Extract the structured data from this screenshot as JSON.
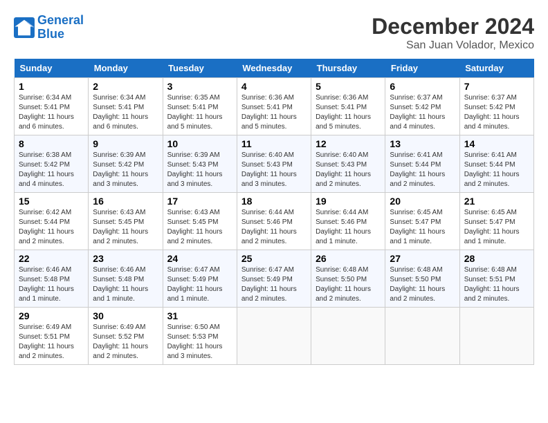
{
  "header": {
    "logo_line1": "General",
    "logo_line2": "Blue",
    "month": "December 2024",
    "location": "San Juan Volador, Mexico"
  },
  "days_of_week": [
    "Sunday",
    "Monday",
    "Tuesday",
    "Wednesday",
    "Thursday",
    "Friday",
    "Saturday"
  ],
  "weeks": [
    [
      {
        "day": "1",
        "info": "Sunrise: 6:34 AM\nSunset: 5:41 PM\nDaylight: 11 hours and 6 minutes."
      },
      {
        "day": "2",
        "info": "Sunrise: 6:34 AM\nSunset: 5:41 PM\nDaylight: 11 hours and 6 minutes."
      },
      {
        "day": "3",
        "info": "Sunrise: 6:35 AM\nSunset: 5:41 PM\nDaylight: 11 hours and 5 minutes."
      },
      {
        "day": "4",
        "info": "Sunrise: 6:36 AM\nSunset: 5:41 PM\nDaylight: 11 hours and 5 minutes."
      },
      {
        "day": "5",
        "info": "Sunrise: 6:36 AM\nSunset: 5:41 PM\nDaylight: 11 hours and 5 minutes."
      },
      {
        "day": "6",
        "info": "Sunrise: 6:37 AM\nSunset: 5:42 PM\nDaylight: 11 hours and 4 minutes."
      },
      {
        "day": "7",
        "info": "Sunrise: 6:37 AM\nSunset: 5:42 PM\nDaylight: 11 hours and 4 minutes."
      }
    ],
    [
      {
        "day": "8",
        "info": "Sunrise: 6:38 AM\nSunset: 5:42 PM\nDaylight: 11 hours and 4 minutes."
      },
      {
        "day": "9",
        "info": "Sunrise: 6:39 AM\nSunset: 5:42 PM\nDaylight: 11 hours and 3 minutes."
      },
      {
        "day": "10",
        "info": "Sunrise: 6:39 AM\nSunset: 5:43 PM\nDaylight: 11 hours and 3 minutes."
      },
      {
        "day": "11",
        "info": "Sunrise: 6:40 AM\nSunset: 5:43 PM\nDaylight: 11 hours and 3 minutes."
      },
      {
        "day": "12",
        "info": "Sunrise: 6:40 AM\nSunset: 5:43 PM\nDaylight: 11 hours and 2 minutes."
      },
      {
        "day": "13",
        "info": "Sunrise: 6:41 AM\nSunset: 5:44 PM\nDaylight: 11 hours and 2 minutes."
      },
      {
        "day": "14",
        "info": "Sunrise: 6:41 AM\nSunset: 5:44 PM\nDaylight: 11 hours and 2 minutes."
      }
    ],
    [
      {
        "day": "15",
        "info": "Sunrise: 6:42 AM\nSunset: 5:44 PM\nDaylight: 11 hours and 2 minutes."
      },
      {
        "day": "16",
        "info": "Sunrise: 6:43 AM\nSunset: 5:45 PM\nDaylight: 11 hours and 2 minutes."
      },
      {
        "day": "17",
        "info": "Sunrise: 6:43 AM\nSunset: 5:45 PM\nDaylight: 11 hours and 2 minutes."
      },
      {
        "day": "18",
        "info": "Sunrise: 6:44 AM\nSunset: 5:46 PM\nDaylight: 11 hours and 2 minutes."
      },
      {
        "day": "19",
        "info": "Sunrise: 6:44 AM\nSunset: 5:46 PM\nDaylight: 11 hours and 1 minute."
      },
      {
        "day": "20",
        "info": "Sunrise: 6:45 AM\nSunset: 5:47 PM\nDaylight: 11 hours and 1 minute."
      },
      {
        "day": "21",
        "info": "Sunrise: 6:45 AM\nSunset: 5:47 PM\nDaylight: 11 hours and 1 minute."
      }
    ],
    [
      {
        "day": "22",
        "info": "Sunrise: 6:46 AM\nSunset: 5:48 PM\nDaylight: 11 hours and 1 minute."
      },
      {
        "day": "23",
        "info": "Sunrise: 6:46 AM\nSunset: 5:48 PM\nDaylight: 11 hours and 1 minute."
      },
      {
        "day": "24",
        "info": "Sunrise: 6:47 AM\nSunset: 5:49 PM\nDaylight: 11 hours and 1 minute."
      },
      {
        "day": "25",
        "info": "Sunrise: 6:47 AM\nSunset: 5:49 PM\nDaylight: 11 hours and 2 minutes."
      },
      {
        "day": "26",
        "info": "Sunrise: 6:48 AM\nSunset: 5:50 PM\nDaylight: 11 hours and 2 minutes."
      },
      {
        "day": "27",
        "info": "Sunrise: 6:48 AM\nSunset: 5:50 PM\nDaylight: 11 hours and 2 minutes."
      },
      {
        "day": "28",
        "info": "Sunrise: 6:48 AM\nSunset: 5:51 PM\nDaylight: 11 hours and 2 minutes."
      }
    ],
    [
      {
        "day": "29",
        "info": "Sunrise: 6:49 AM\nSunset: 5:51 PM\nDaylight: 11 hours and 2 minutes."
      },
      {
        "day": "30",
        "info": "Sunrise: 6:49 AM\nSunset: 5:52 PM\nDaylight: 11 hours and 2 minutes."
      },
      {
        "day": "31",
        "info": "Sunrise: 6:50 AM\nSunset: 5:53 PM\nDaylight: 11 hours and 3 minutes."
      },
      {
        "day": "",
        "info": ""
      },
      {
        "day": "",
        "info": ""
      },
      {
        "day": "",
        "info": ""
      },
      {
        "day": "",
        "info": ""
      }
    ]
  ]
}
